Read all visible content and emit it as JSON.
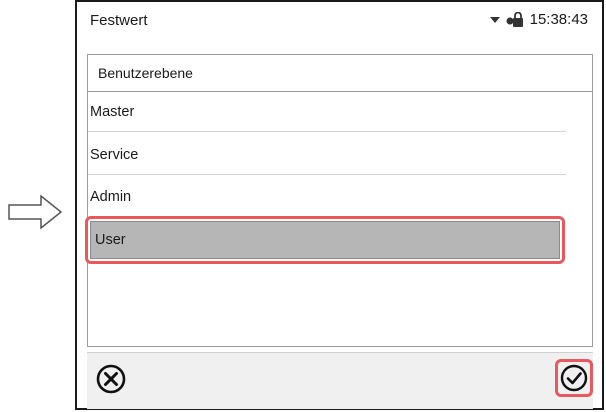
{
  "status_bar": {
    "mode": "Festwert",
    "time": "15:38:43",
    "icons": [
      "dropdown-triangle-icon",
      "lock-icon"
    ]
  },
  "panel": {
    "title": "Benutzerebene",
    "items": [
      {
        "label": "Master",
        "selected": false
      },
      {
        "label": "Service",
        "selected": false
      },
      {
        "label": "Admin",
        "selected": false
      },
      {
        "label": "User",
        "selected": true
      }
    ]
  },
  "footer": {
    "cancel_icon": "circle-x-icon",
    "confirm_icon": "circle-check-icon"
  },
  "colors": {
    "selection_bg": "#b6b6b6",
    "highlight_outline": "#e8585c",
    "footer_bg": "#f0f0f0"
  }
}
